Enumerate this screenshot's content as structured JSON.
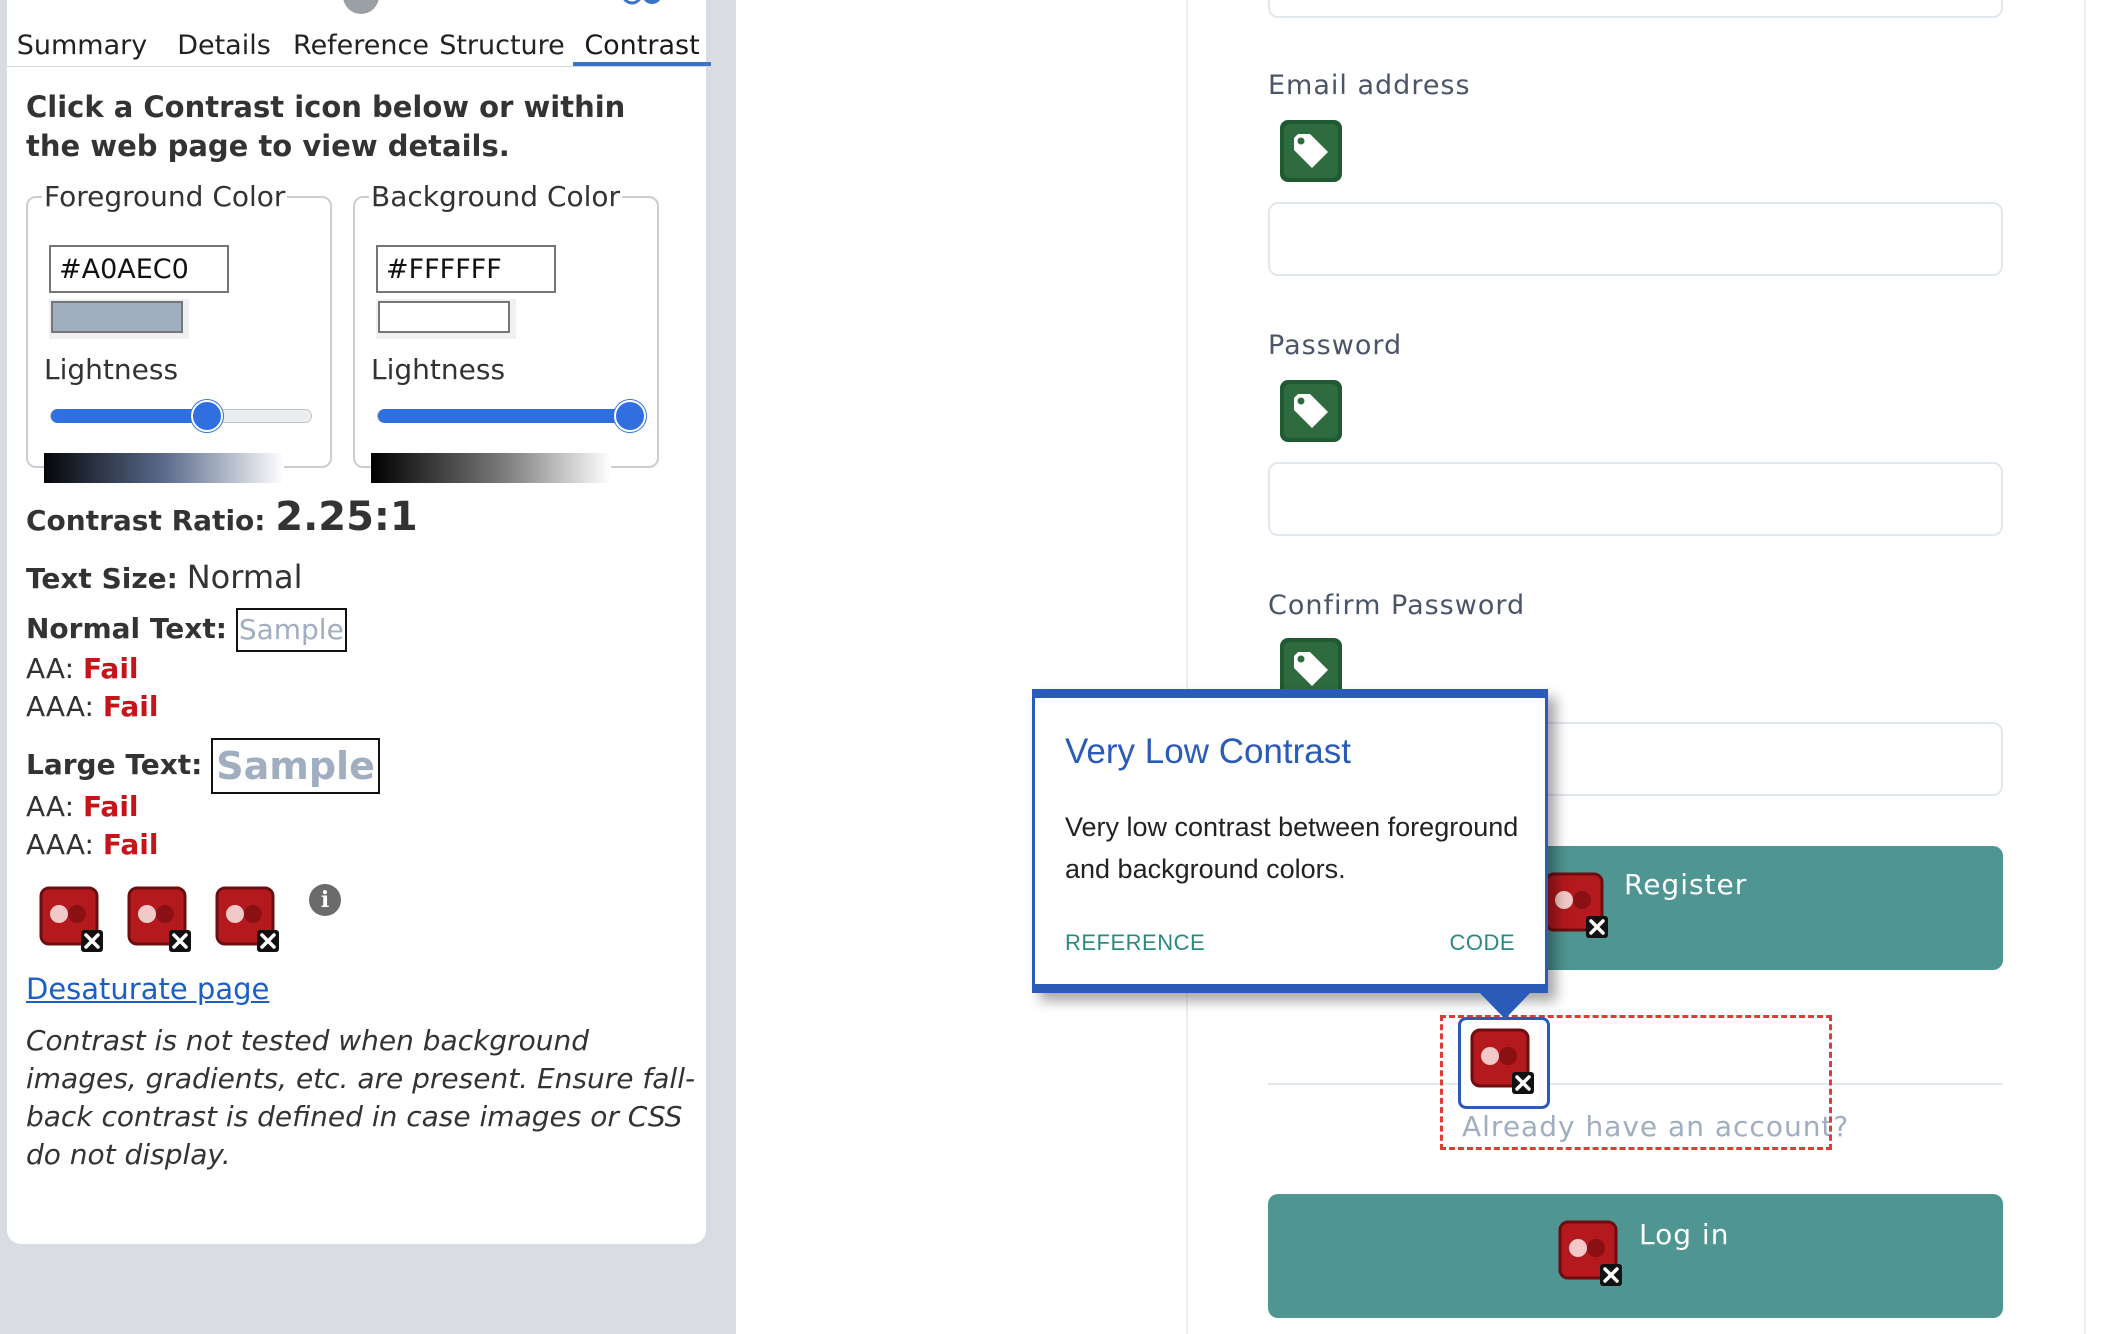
{
  "tabs": [
    {
      "label": "Summary",
      "icon": "home-icon"
    },
    {
      "label": "Details",
      "icon": "list-icon"
    },
    {
      "label": "Reference",
      "icon": "info-icon"
    },
    {
      "label": "Structure",
      "icon": "hierarchy-icon"
    },
    {
      "label": "Contrast",
      "icon": "contrast-icon",
      "active": true
    }
  ],
  "instructions": "Click a Contrast icon below or within the web page to view details.",
  "foreground": {
    "legend": "Foreground Color",
    "hex": "#A0AEC0",
    "lightness_label": "Lightness",
    "lightness": 0.6
  },
  "background": {
    "legend": "Background Color",
    "hex": "#FFFFFF",
    "lightness_label": "Lightness",
    "lightness": 0.97
  },
  "results": {
    "ratio_label": "Contrast Ratio:",
    "ratio_value": "2.25:1",
    "size_label": "Text Size:",
    "size_value": "Normal",
    "normal_label": "Normal Text:",
    "large_label": "Large Text:",
    "sample": "Sample",
    "aa_label": "AA:",
    "aaa_label": "AAA:",
    "normal_aa": "Fail",
    "normal_aaa": "Fail",
    "large_aa": "Fail",
    "large_aaa": "Fail"
  },
  "info_glyph": "i",
  "desaturate_link": "Desaturate page",
  "note": "Contrast is not tested when background images, gradients, etc. are present. Ensure fall-back contrast is defined in case images or CSS do not display.",
  "form": {
    "email_label": "Email address",
    "password_label": "Password",
    "confirm_label": "Confirm Password",
    "register_button": "Register",
    "already_text": "Already have an account?",
    "login_button": "Log in"
  },
  "tooltip": {
    "title": "Very Low Contrast",
    "body": "Very low contrast between foreground and background colors.",
    "reference_link": "REFERENCE",
    "code_link": "CODE"
  },
  "colors": {
    "accent_blue": "#2a5bb8",
    "fail_red": "#c7141a",
    "button_teal": "#4f9592",
    "tag_green": "#2e6b3e",
    "contrast_icon_red": "#b3191d"
  }
}
